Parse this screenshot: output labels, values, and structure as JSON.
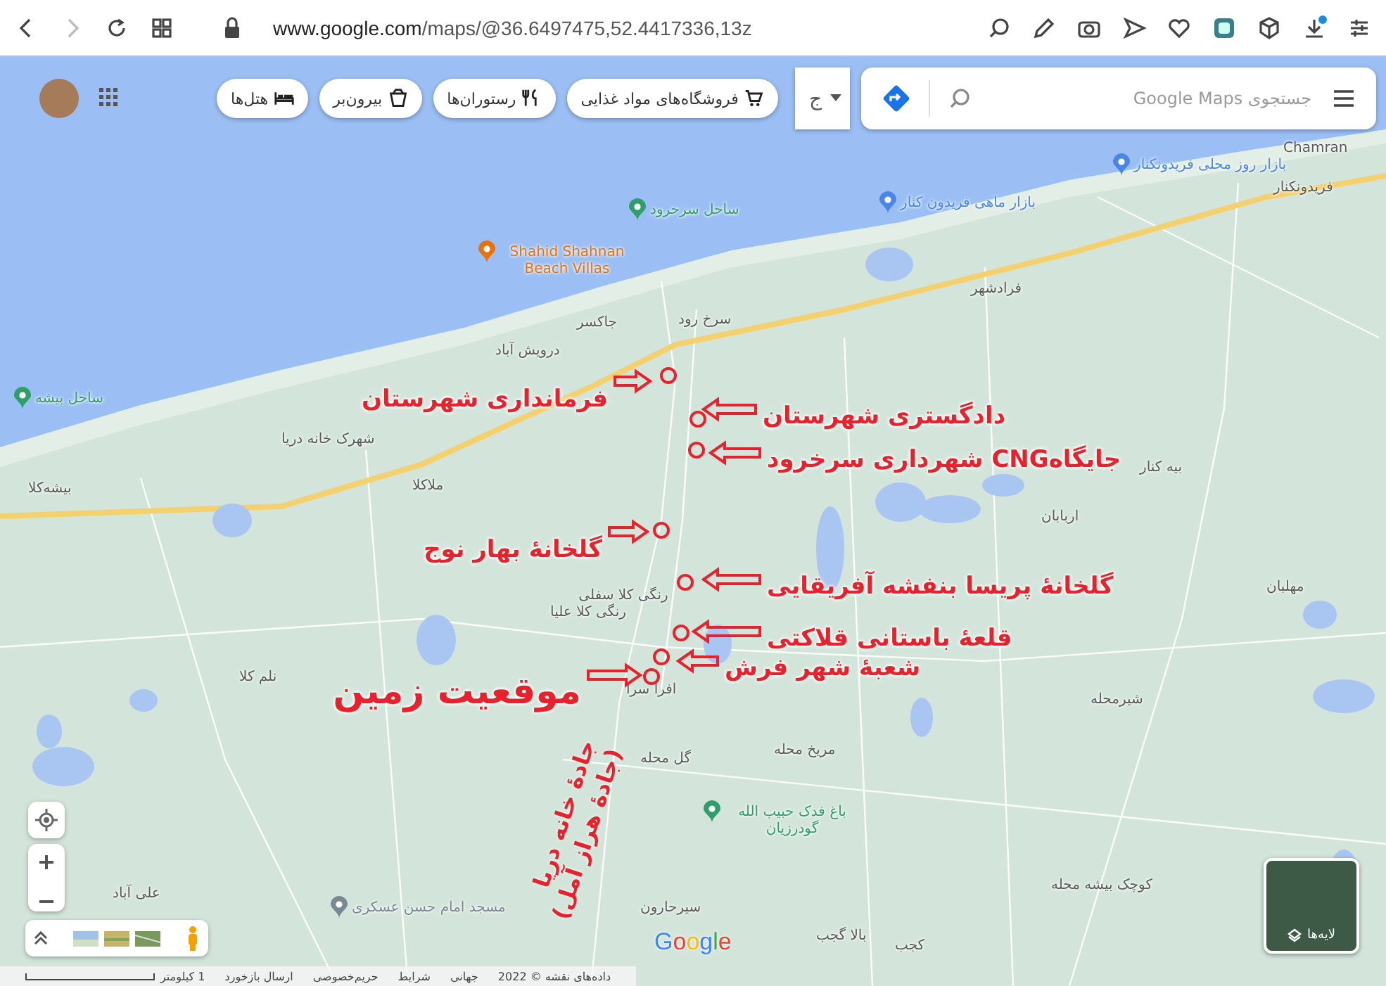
{
  "browser": {
    "url_host": "www.google.com",
    "url_path": "/maps/@36.6497475,52.4417336,13z"
  },
  "search": {
    "placeholder": "جستجوی Google Maps"
  },
  "category_dropdown": {
    "label": "ج"
  },
  "chips": [
    {
      "label": "فروشگاه‌های مواد غذایی",
      "kind": "cart"
    },
    {
      "label": "رستوران‌ها",
      "kind": "cutlery"
    },
    {
      "label": "بیرون‌بر",
      "kind": "takeout"
    },
    {
      "label": "هتل‌ها",
      "kind": "bed"
    }
  ],
  "map_labels": [
    {
      "text": "Chamran",
      "kind": "place"
    },
    {
      "text": "بازار روز محلی فریدونکنار",
      "kind": "poi",
      "color": "#4a86e8"
    },
    {
      "text": "فریدونکنار",
      "kind": "place"
    },
    {
      "text": "بازار ماهی فریدون کنار",
      "kind": "poi",
      "color": "#4a86e8"
    },
    {
      "text": "ساحل سرخرود",
      "kind": "poi",
      "color": "#2f9e6a"
    },
    {
      "text": "Shahid Shahnan Beach Villas",
      "kind": "poi",
      "color": "#e8710a"
    },
    {
      "text": "فرادشهر",
      "kind": "place"
    },
    {
      "text": "جاکسر",
      "kind": "place"
    },
    {
      "text": "سرخ رود",
      "kind": "place"
    },
    {
      "text": "درویش آباد",
      "kind": "place"
    },
    {
      "text": "ساحل بیشه",
      "kind": "poi",
      "color": "#2f9e6a"
    },
    {
      "text": "شهرک خانه دریا",
      "kind": "place"
    },
    {
      "text": "بیه کنار",
      "kind": "place"
    },
    {
      "text": "بیشه‌کلا",
      "kind": "place"
    },
    {
      "text": "ملاکلا",
      "kind": "place"
    },
    {
      "text": "اربابان",
      "kind": "place"
    },
    {
      "text": "مهلبان",
      "kind": "place"
    },
    {
      "text": "رنگی کلا سفلی",
      "kind": "place"
    },
    {
      "text": "رنگی کلا علیا",
      "kind": "place"
    },
    {
      "text": "نلم کلا",
      "kind": "place"
    },
    {
      "text": "افرا سرا",
      "kind": "place"
    },
    {
      "text": "شیرمحله",
      "kind": "place"
    },
    {
      "text": "مریخ محله",
      "kind": "place"
    },
    {
      "text": "گل محله",
      "kind": "place"
    },
    {
      "text": "باغ فدک حبیب الله گودرزیان",
      "kind": "poi",
      "color": "#2f9e6a"
    },
    {
      "text": "کوچک بیشه محله",
      "kind": "place"
    },
    {
      "text": "علی آباد",
      "kind": "place"
    },
    {
      "text": "سیرحارون",
      "kind": "place"
    },
    {
      "text": "مسجد امام حسن عسکری",
      "kind": "poi",
      "color": "#7b8794"
    },
    {
      "text": "بالا گجب",
      "kind": "place"
    },
    {
      "text": "کجب",
      "kind": "place"
    }
  ],
  "annotations": [
    {
      "text": "دادگستری شهرستان",
      "kind": "left"
    },
    {
      "text": "فرمانداری شهرستان",
      "kind": "right"
    },
    {
      "text": "جایگاهCNG شهرداری سرخرود",
      "kind": "left"
    },
    {
      "text": "گلخانهٔ بهار نوج",
      "kind": "right"
    },
    {
      "text": "گلخانهٔ پریسا بنفشه آفریقایی",
      "kind": "left"
    },
    {
      "text": "قلعهٔ باستانی قلاکتی",
      "kind": "left"
    },
    {
      "text": "شعبهٔ شهر فرش",
      "kind": "left"
    },
    {
      "text": "موقعیت زمین",
      "kind": "right"
    }
  ],
  "road_note": [
    "جادهٔ خانه دریا",
    "(جادهٔ هراز آمل)"
  ],
  "logo": "Google",
  "layers_button": {
    "label": "لایه‌ها"
  },
  "footer": {
    "map_data": "داده‌های نقشه © 2022",
    "links": [
      "جهانی",
      "شرایط",
      "حریم‌خصوصی",
      "ارسال بازخورد"
    ],
    "scale": "1 کیلومتر"
  }
}
